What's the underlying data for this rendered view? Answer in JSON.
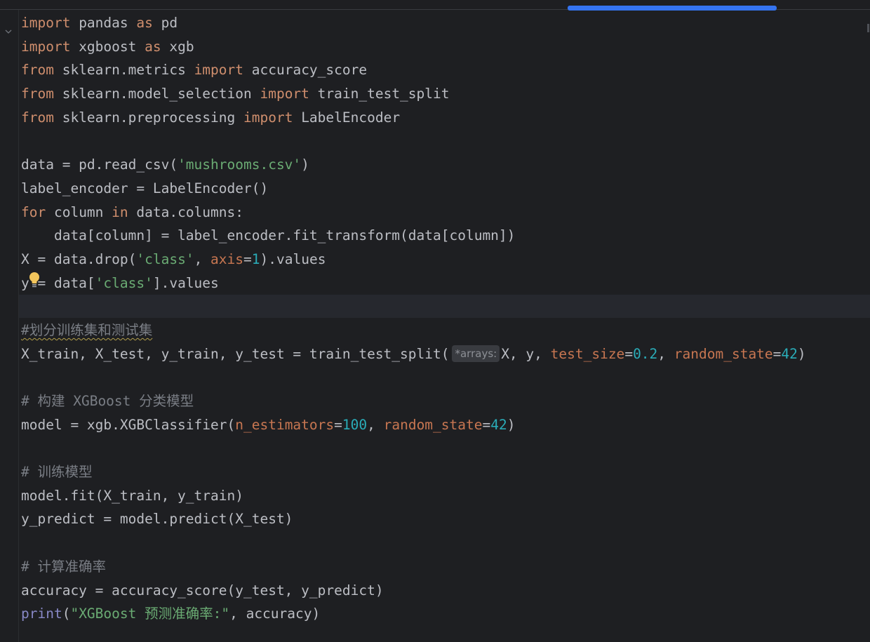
{
  "editor": {
    "tokens": {
      "import": "import",
      "from": "from",
      "as": "as",
      "for": "for",
      "in": "in",
      "print": "print"
    },
    "lines": {
      "l1_mod": " pandas ",
      "l1_alias": " pd",
      "l2_mod": " xgboost ",
      "l2_alias": " xgb",
      "l3_mod": " sklearn.metrics ",
      "l3_name": " accuracy_score",
      "l4_mod": " sklearn.model_selection ",
      "l4_name": " train_test_split",
      "l5_mod": " sklearn.preprocessing ",
      "l5_name": " LabelEncoder",
      "l7_pre": "data = pd.read_csv(",
      "l7_str": "'mushrooms.csv'",
      "l7_post": ")",
      "l8": "label_encoder = LabelEncoder()",
      "l9_a": " column ",
      "l9_b": " data.columns:",
      "l10": "    data[column] = label_encoder.fit_transform(data[column])",
      "l11_pre": "X = data.drop(",
      "l11_str": "'class'",
      "l11_sep": ", ",
      "l11_prm": "axis",
      "l11_eq": "=",
      "l11_num": "1",
      "l11_post": ").values",
      "l12_pre": "y = data[",
      "l12_str": "'class'",
      "l12_post": "].values",
      "l14_comment": "#划分训练集和测试集",
      "l15_pre": "X_train, X_test, y_train, y_test = train_test_split(",
      "l15_hint": "*arrays:",
      "l15_args": "X, y, ",
      "l15_prm1": "test_size",
      "l15_eq1": "=",
      "l15_num1": "0.2",
      "l15_sep": ", ",
      "l15_prm2": "random_state",
      "l15_eq2": "=",
      "l15_num2": "42",
      "l15_post": ")",
      "l17_comment": "# 构建 XGBoost 分类模型",
      "l18_pre": "model = xgb.XGBClassifier(",
      "l18_prm1": "n_estimators",
      "l18_eq1": "=",
      "l18_num1": "100",
      "l18_sep": ", ",
      "l18_prm2": "random_state",
      "l18_eq2": "=",
      "l18_num2": "42",
      "l18_post": ")",
      "l20_comment": "# 训练模型",
      "l21": "model.fit(X_train, y_train)",
      "l22": "y_predict = model.predict(X_test)",
      "l24_comment": "# 计算准确率",
      "l25": "accuracy = accuracy_score(y_test, y_predict)",
      "l26_pre": "(",
      "l26_str": "\"XGBoost 预测准确率:\"",
      "l26_post": ", accuracy)"
    },
    "colors": {
      "background": "#1e1f22",
      "keyword": "#cf8e6d",
      "string": "#6aab73",
      "number": "#2aacb8",
      "parameter": "#c77651",
      "comment": "#7a7e85",
      "accent": "#3574f0"
    },
    "icons": {
      "fold": "chevron-down-icon",
      "intention": "lightbulb-icon"
    }
  }
}
